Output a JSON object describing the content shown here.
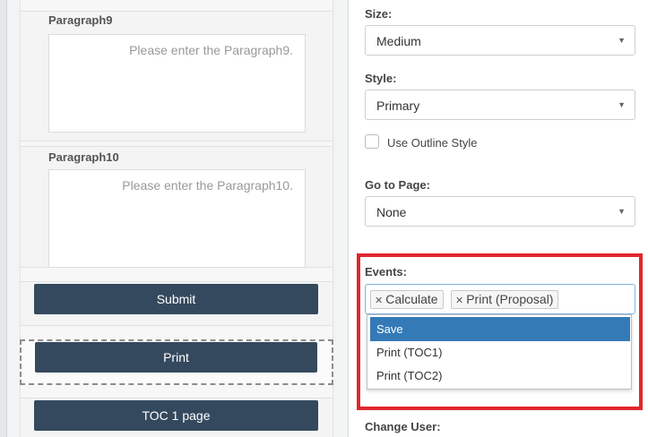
{
  "canvas": {
    "paragraphs": [
      {
        "label": "Paragraph9",
        "placeholder": "Please enter the Paragraph9."
      },
      {
        "label": "Paragraph10",
        "placeholder": "Please enter the Paragraph10."
      }
    ],
    "buttons": [
      {
        "label": "Submit"
      },
      {
        "label": "Print"
      },
      {
        "label": "TOC 1 page"
      }
    ]
  },
  "panel": {
    "size": {
      "label": "Size:",
      "value": "Medium"
    },
    "style": {
      "label": "Style:",
      "value": "Primary"
    },
    "outline": {
      "label": "Use Outline Style",
      "checked": false
    },
    "goto": {
      "label": "Go to Page:",
      "value": "None"
    },
    "events": {
      "label": "Events:",
      "selected": [
        "Calculate",
        "Print (Proposal)"
      ],
      "options": [
        "Save",
        "Print (TOC1)",
        "Print (TOC2)"
      ],
      "highlighted": "Save",
      "obscured_value": "None"
    },
    "change_user": {
      "label": "Change User:"
    }
  },
  "colors": {
    "button_dark": "#34495e",
    "highlight": "#e0262e",
    "option_selected": "#337ab7"
  }
}
